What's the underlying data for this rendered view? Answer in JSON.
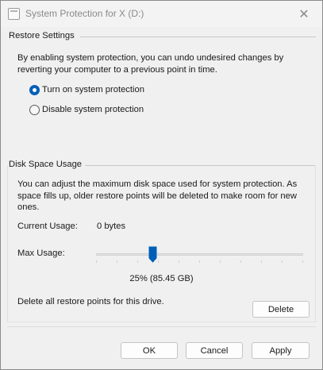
{
  "window": {
    "title": "System Protection for X (D:)",
    "close_glyph": "✕"
  },
  "restore_settings": {
    "heading": "Restore Settings",
    "description_line1": "By enabling system protection, you can undo undesired changes by",
    "description_line2": "reverting your computer to a previous point in time.",
    "options": [
      {
        "label": "Turn on system protection",
        "selected": true
      },
      {
        "label": "Disable system protection",
        "selected": false
      }
    ]
  },
  "disk_space": {
    "heading": "Disk Space Usage",
    "description_line1": "You can adjust the maximum disk space used for system protection. As",
    "description_line2": "space fills up, older restore points will be deleted to make room for new",
    "description_line3": "ones.",
    "current_usage_label": "Current Usage:",
    "current_usage_value": "0 bytes",
    "max_usage_label": "Max Usage:",
    "max_usage_percent": 25,
    "max_usage_text": "25% (85.45 GB)",
    "delete_text": "Delete all restore points for this drive.",
    "delete_label": "Delete"
  },
  "footer": {
    "ok_label": "OK",
    "cancel_label": "Cancel",
    "apply_label": "Apply"
  },
  "colors": {
    "accent": "#005fb8",
    "background": "#f0f0f0"
  }
}
